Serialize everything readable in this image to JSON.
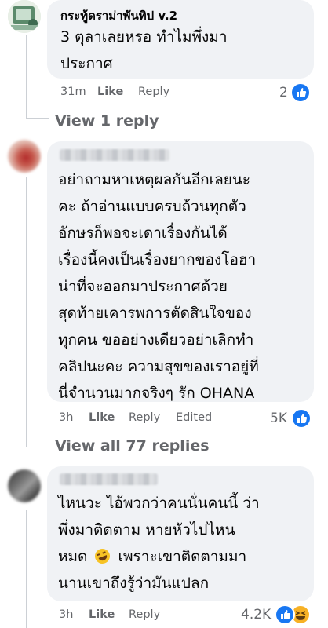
{
  "comment1": {
    "author": "กระทู้ดราม่าพันทิป v.2",
    "lines": [
      "3 ตุลาเลยหรอ ทำไมพึ่งมา",
      "ประกาศ"
    ],
    "time": "31m",
    "like": "Like",
    "reply": "Reply",
    "reaction_count": "2",
    "reactions": [
      "like-icon"
    ],
    "view_replies": "View 1 reply"
  },
  "comment2": {
    "lines": [
      "อย่าถามหาเหตุผลกันอีกเลยนะ",
      "คะ ถ้าอ่านแบบครบถ้วนทุกตัว",
      "อักษรก็พอจะเดาเรื่องกันได้",
      "เรื่องนี้คงเป็นเรื่องยากของโอฮา",
      "น่าที่จะออกมาประกาศด้วย",
      "สุดท้ายเคารพการตัดสินใจของ",
      "ทุกคน ขออย่างเดียวอย่าเลิกทำ",
      "คลิปนะคะ ความสุขของเราอยู่ที่",
      "นี่จำนวนมากจริงๆ รัก OHANA"
    ],
    "time": "3h",
    "like": "Like",
    "reply": "Reply",
    "edited": "Edited",
    "reaction_count": "5K",
    "reactions": [
      "like-icon"
    ],
    "view_replies": "View all 77 replies"
  },
  "comment3": {
    "line1": "ไหนวะ ไอ้พวกว่าคนนั่นคนนี้ ว่า",
    "line2": "พึ่งมาติดตาม หายหัวไปไหน",
    "line3_before": "หมด",
    "line3_after": "เพราะเขาติดตามมา",
    "line4": "นานเขาถึงรู้ว่ามันแปลก",
    "time": "3h",
    "like": "Like",
    "reply": "Reply",
    "reaction_count": "4.2K",
    "reactions": [
      "like-icon",
      "haha-icon"
    ]
  },
  "colors": {
    "bubble": "#f0f2f5",
    "like_blue": "#1877f2",
    "meta_gray": "#65676b",
    "text": "#050505"
  }
}
